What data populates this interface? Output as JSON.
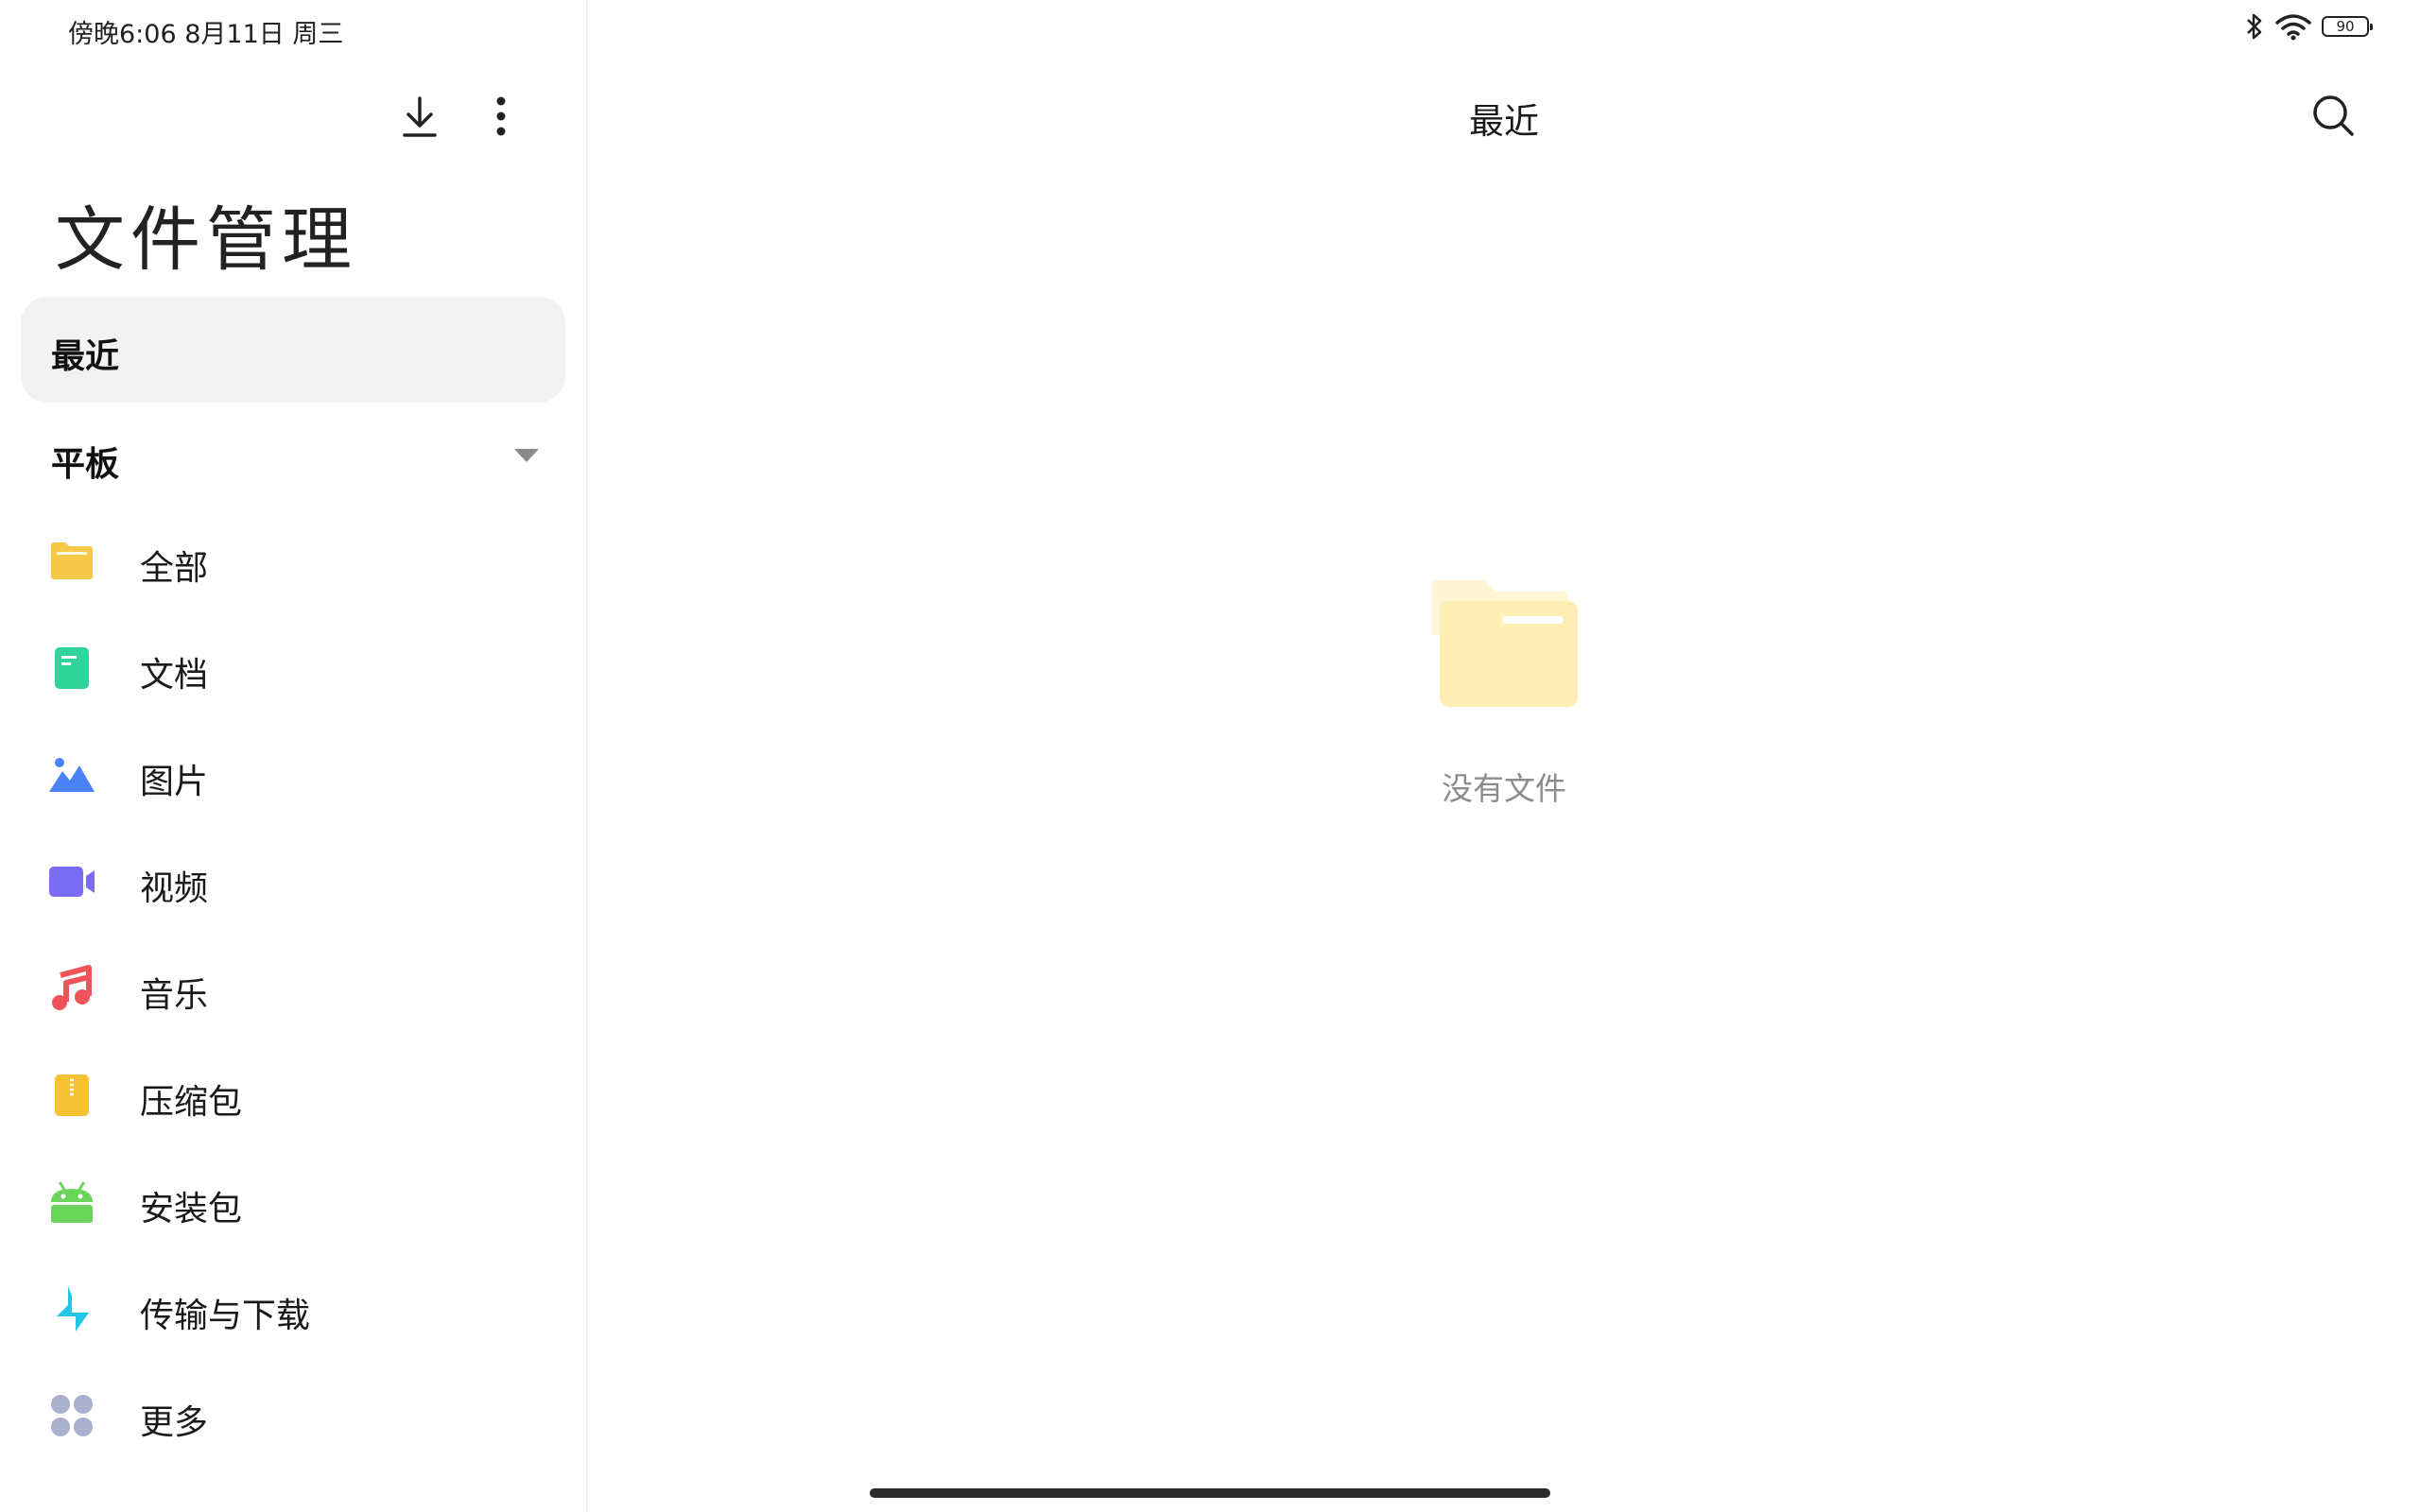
{
  "status_bar": {
    "time_date": "傍晚6:06  8月11日 周三",
    "battery_level": "90"
  },
  "app_title": "文件管理",
  "sidebar": {
    "recent_label": "最近",
    "section_label": "平板",
    "categories": [
      {
        "label": "全部",
        "icon": "folder-icon",
        "color": "#F7C948"
      },
      {
        "label": "文档",
        "icon": "document-icon",
        "color": "#2FD49A"
      },
      {
        "label": "图片",
        "icon": "image-icon",
        "color": "#4C82F7"
      },
      {
        "label": "视频",
        "icon": "video-icon",
        "color": "#7B6CF6"
      },
      {
        "label": "音乐",
        "icon": "music-icon",
        "color": "#F0545B"
      },
      {
        "label": "压缩包",
        "icon": "archive-icon",
        "color": "#F7C233"
      },
      {
        "label": "安装包",
        "icon": "android-icon",
        "color": "#6BD45A"
      },
      {
        "label": "传输与下载",
        "icon": "transfer-icon",
        "color": "#23C5E6"
      },
      {
        "label": "更多",
        "icon": "more-grid-icon",
        "color": "#A9B1CF"
      }
    ]
  },
  "main": {
    "title": "最近",
    "empty_text": "没有文件"
  }
}
